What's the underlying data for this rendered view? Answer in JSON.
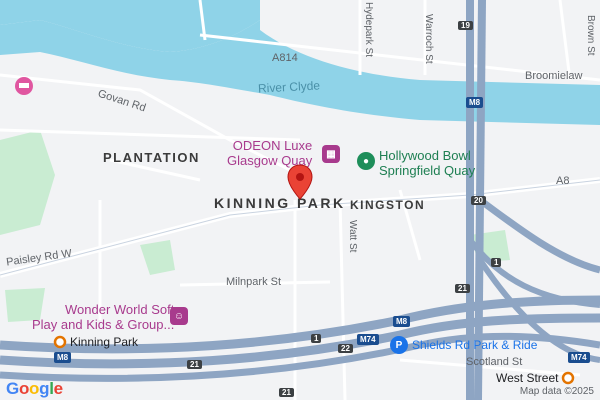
{
  "map": {
    "areas": {
      "plantation": "PLANTATION",
      "kinning_park": "KINNING PARK",
      "kingston": "KINGSTON"
    },
    "water": {
      "river_clyde": "River Clyde"
    },
    "roads": {
      "a814": "A814",
      "govan_rd": "Govan Rd",
      "broomielaw": "Broomielaw",
      "hydepark_st": "Hydepark St",
      "warroch_st": "Warroch St",
      "brown_st": "Brown St",
      "watt_st": "Watt St",
      "a8": "A8",
      "paisley_rd_w": "Paisley Rd W",
      "milnpark_st": "Milnpark St",
      "scotland_st": "Scotland St"
    },
    "shields": {
      "m8_a": "M8",
      "m8_b": "M8",
      "m8_c": "M8",
      "m74_a": "M74",
      "m74_b": "M74"
    },
    "junctions": {
      "j19": "19",
      "j20": "20",
      "j1": "1",
      "j21_a": "21",
      "j21_b": "21",
      "j22": "22",
      "j1_b": "1",
      "j21_c": "21"
    },
    "pois": {
      "odeon": "ODEON Luxe\nGlasgow Quay",
      "hollywood_bowl": "Hollywood Bowl\nSpringfield Quay",
      "wonder_world": "Wonder World Soft\nPlay and Kids & Group...",
      "shields_park_ride": "Shields Rd Park & Ride"
    },
    "stations": {
      "kinning_park": "Kinning Park",
      "west_street": "West Street"
    },
    "google_logo": [
      "G",
      "o",
      "o",
      "g",
      "l",
      "e"
    ],
    "google_colors": [
      "#4285F4",
      "#EA4335",
      "#FBBC05",
      "#4285F4",
      "#34A853",
      "#EA4335"
    ],
    "attribution": "Map data ©2025",
    "colors": {
      "water": "#8fd3e8",
      "motorway": "#8ea5c3",
      "park": "#c9ecd2",
      "pin": "#ea4335"
    }
  }
}
